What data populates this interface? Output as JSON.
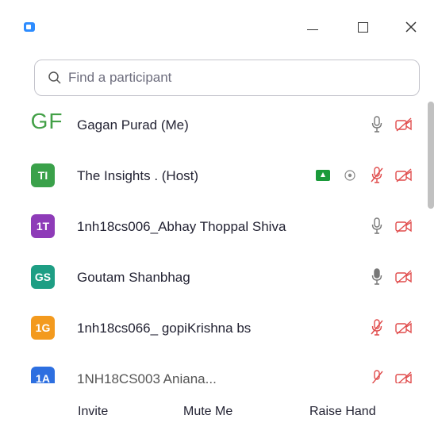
{
  "window": {
    "controls": {
      "minimize": "minimize",
      "maximize": "maximize",
      "close": "close"
    }
  },
  "search": {
    "placeholder": "Find a participant",
    "value": ""
  },
  "participants": [
    {
      "initials": "GF",
      "name": "Gagan Purad (Me)",
      "avatar_color": "",
      "mic": "unmuted",
      "video": "off"
    },
    {
      "initials": "TI",
      "name": "The Insights . (Host)",
      "avatar_color": "#3aa14a",
      "mic": "muted",
      "video": "off",
      "sharing": true,
      "recording": true
    },
    {
      "initials": "1T",
      "name": "1nh18cs006_Abhay Thoppal Shiva",
      "avatar_color": "#8e3bb8",
      "mic": "unmuted",
      "video": "off"
    },
    {
      "initials": "GS",
      "name": "Goutam Shanbhag",
      "avatar_color": "#1e9e84",
      "mic": "unmuted",
      "video": "off"
    },
    {
      "initials": "1G",
      "name": "1nh18cs066_ gopiKrishna bs",
      "avatar_color": "#f39a1e",
      "mic": "muted",
      "video": "off"
    },
    {
      "initials": "1A",
      "name": "1NH18CS003 Anjana...",
      "avatar_color": "#2d6fe0",
      "mic": "muted",
      "video": "off"
    }
  ],
  "footer": {
    "invite": "Invite",
    "mute_me": "Mute Me",
    "raise_hand": "Raise Hand"
  },
  "colors": {
    "accent": "#2d8cff",
    "muted_red": "#e04c4c",
    "share_green": "#1a9a3a"
  }
}
